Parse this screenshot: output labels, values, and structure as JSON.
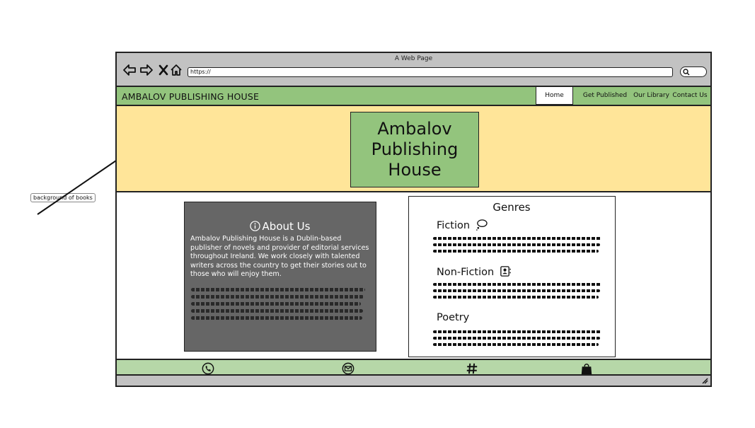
{
  "browser": {
    "title": "A Web Page",
    "url": "https://"
  },
  "navbar": {
    "brand": "AMBALOV PUBLISHING HOUSE",
    "links": [
      "Home",
      "Get Published",
      "Our Library",
      "Contact Us"
    ]
  },
  "hero": {
    "title_lines": [
      "Ambalov",
      "Publishing",
      "House"
    ]
  },
  "about": {
    "heading": "About Us",
    "text": "Ambalov Publishing House is a Dublin-based publisher of novels and provider of editorial services throughout Ireland. We work closely with talented writers across the country to get their stories out to those who will enjoy them."
  },
  "genres": {
    "heading": "Genres",
    "items": [
      "Fiction",
      "Non-Fiction",
      "Poetry"
    ]
  },
  "footer": {
    "icons": [
      "phone-icon",
      "email-icon",
      "hashtag-icon",
      "shopping-bag-icon"
    ]
  },
  "annotation": {
    "label": "background of books"
  },
  "colors": {
    "nav_green": "#93c47d",
    "hero_yellow": "#ffe599",
    "footer_green": "#b6d7a8",
    "card_gray": "#666666",
    "chrome_gray": "#c2c2c2"
  }
}
